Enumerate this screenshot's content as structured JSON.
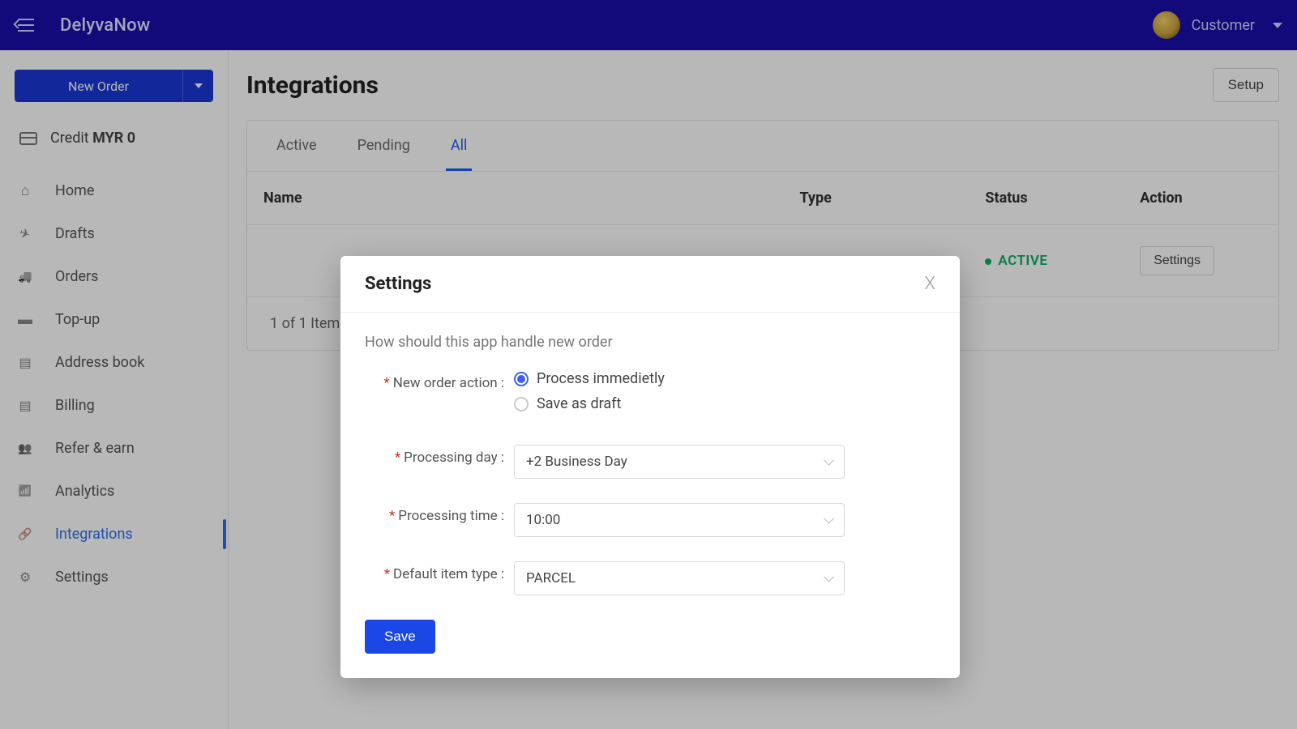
{
  "brand": "DelyvaNow",
  "user": {
    "role": "Customer"
  },
  "sidebar": {
    "new_order_label": "New Order",
    "credit_label": "Credit",
    "credit_amount": "MYR 0",
    "items": [
      {
        "label": "Home"
      },
      {
        "label": "Drafts"
      },
      {
        "label": "Orders"
      },
      {
        "label": "Top-up"
      },
      {
        "label": "Address book"
      },
      {
        "label": "Billing"
      },
      {
        "label": "Refer & earn"
      },
      {
        "label": "Analytics"
      },
      {
        "label": "Integrations"
      },
      {
        "label": "Settings"
      }
    ]
  },
  "page": {
    "title": "Integrations",
    "setup_button": "Setup",
    "tabs": {
      "active": "Active",
      "pending": "Pending",
      "all": "All"
    },
    "columns": {
      "name": "Name",
      "type": "Type",
      "status": "Status",
      "action": "Action"
    },
    "row": {
      "status": "ACTIVE",
      "action_button": "Settings"
    },
    "pager": "1 of 1 Item"
  },
  "modal": {
    "title": "Settings",
    "helper": "How should this app handle new order",
    "labels": {
      "new_order_action": "New order action",
      "processing_day": "Processing day",
      "processing_time": "Processing time",
      "default_item_type": "Default item type"
    },
    "options": {
      "process_now": "Process immedietly",
      "save_draft": "Save as draft"
    },
    "values": {
      "processing_day": "+2 Business Day",
      "processing_time": "10:00",
      "default_item_type": "PARCEL"
    },
    "save_button": "Save"
  }
}
